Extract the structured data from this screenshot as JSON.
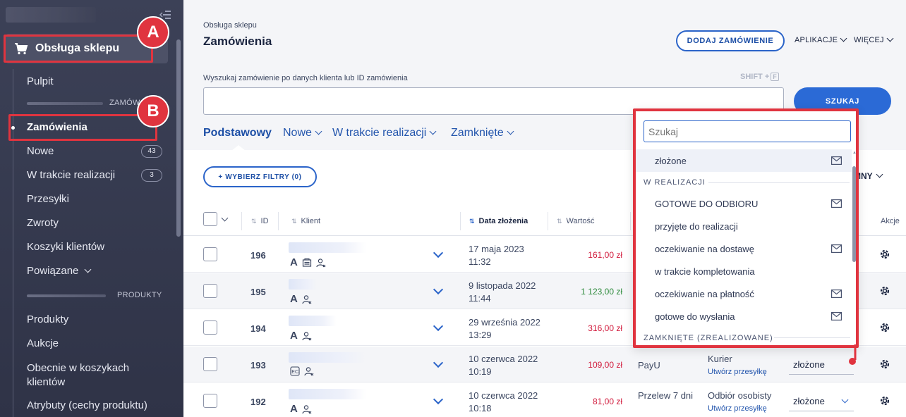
{
  "sidebar": {
    "shop_label": "Obsługa sklepu",
    "items": [
      {
        "label": "Pulpit"
      },
      {
        "label": "Zamówienia"
      },
      {
        "label": "Nowe",
        "badge": "43"
      },
      {
        "label": "W trakcie realizacji",
        "badge": "3"
      },
      {
        "label": "Przesyłki"
      },
      {
        "label": "Zwroty"
      },
      {
        "label": "Koszyki klientów"
      },
      {
        "label": "Powiązane"
      },
      {
        "label": "Produkty"
      },
      {
        "label": "Aukcje"
      },
      {
        "label": "Obecnie w koszykach klientów"
      },
      {
        "label": "Atrybuty (cechy produktu)"
      }
    ],
    "section_orders": "ZAMÓW",
    "section_products": "PRODUKTY"
  },
  "annotations": {
    "a": "A",
    "b": "B",
    "color": "#e0343f"
  },
  "header": {
    "breadcrumb": "Obsługa sklepu",
    "title": "Zamówienia",
    "add_button": "DODAJ ZAMÓWIENIE",
    "menu_apps": "APLIKACJE",
    "menu_more": "WIĘCEJ"
  },
  "search": {
    "label": "Wyszukaj zamówienie po danych klienta lub ID zamówienia",
    "shortcut": "SHIFT +",
    "shortcut_key": "F",
    "button": "SZUKAJ"
  },
  "tabs": [
    {
      "label": "Podstawowy"
    },
    {
      "label": "Nowe"
    },
    {
      "label": "W trakcie realizacji"
    },
    {
      "label": "Zamknięte"
    }
  ],
  "toolbar": {
    "filter_button": "+ WYBIERZ FILTRY (0)",
    "columns": "MNY"
  },
  "table": {
    "headers": {
      "id": "ID",
      "client": "Klient",
      "date": "Data złożenia",
      "value": "Wartość",
      "actions": "Akcje"
    },
    "rows": [
      {
        "id": "196",
        "date1": "17 maja 2023",
        "date2": "11:32",
        "value": "161,00 zł"
      },
      {
        "id": "195",
        "date1": "9 listopada 2022",
        "date2": "11:44",
        "value": "1 123,00 zł"
      },
      {
        "id": "194",
        "date1": "29 września 2022",
        "date2": "13:29",
        "value": "316,00 zł"
      },
      {
        "id": "193",
        "date1": "10 czerwca 2022",
        "date2": "10:19",
        "value": "109,00 zł",
        "payment": "PayU",
        "shipping": "Kurier",
        "shipping_link": "Utwórz przesyłkę",
        "status": "złożone"
      },
      {
        "id": "192",
        "date1": "10 czerwca 2022",
        "date2": "10:18",
        "value": "81,00 zł",
        "payment": "Przelew 7 dni",
        "shipping": "Odbiór osobisty",
        "shipping_link": "Utwórz przesyłkę",
        "status": "złożone"
      }
    ]
  },
  "dropdown": {
    "placeholder": "Szukaj",
    "first_option": "złożone",
    "group_in_progress": "W REALIZACJI",
    "options": [
      {
        "label": "GOTOWE DO ODBIORU",
        "mail": true
      },
      {
        "label": "przyjęte do realizacji",
        "mail": false
      },
      {
        "label": "oczekiwanie na dostawę",
        "mail": true
      },
      {
        "label": "w trakcie kompletowania",
        "mail": false
      },
      {
        "label": "oczekiwanie na płatność",
        "mail": true
      },
      {
        "label": "gotowe do wysłania",
        "mail": true
      }
    ],
    "group_closed": "ZAMKNIĘTE (ZREALIZOWANE)"
  }
}
